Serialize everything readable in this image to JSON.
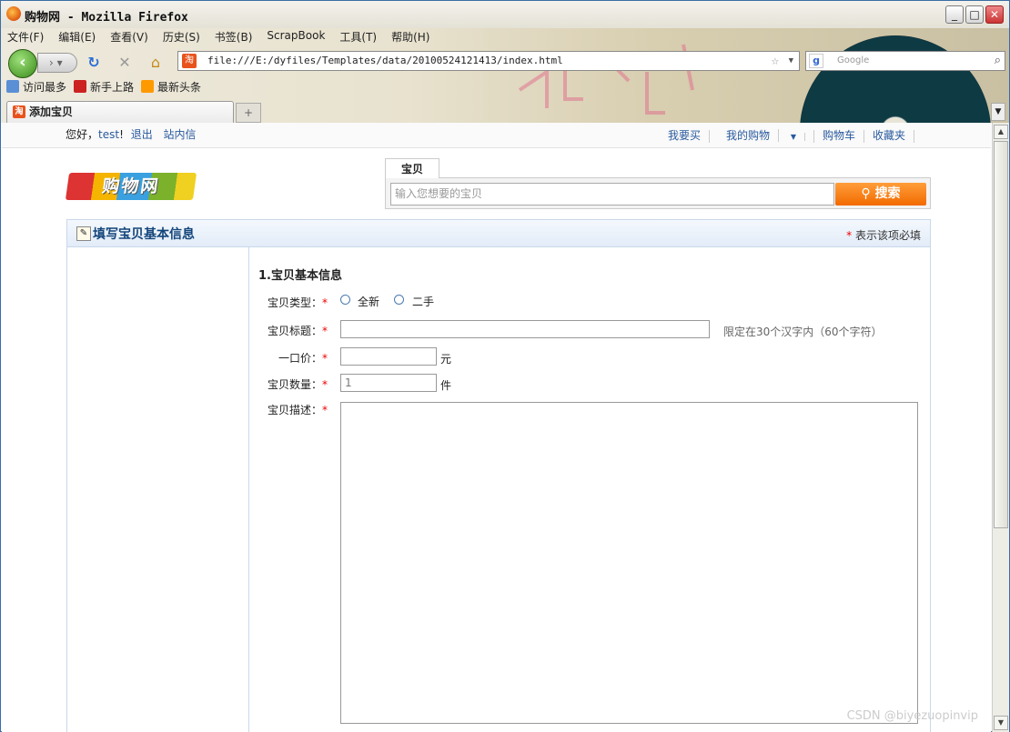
{
  "window": {
    "title": "购物网 - Mozilla Firefox"
  },
  "menubar": [
    "文件(F)",
    "编辑(E)",
    "查看(V)",
    "历史(S)",
    "书签(B)",
    "ScrapBook",
    "工具(T)",
    "帮助(H)"
  ],
  "address": {
    "url": "file:///E:/dyfiles/Templates/data/20100524121413/index.html",
    "favicon": "淘"
  },
  "searchbar": {
    "placeholder": "Google"
  },
  "bookmarks": [
    "访问最多",
    "新手上路",
    "最新头条"
  ],
  "tab": {
    "label": "添加宝贝",
    "new_tab": "+"
  },
  "site": {
    "greeting": "您好，",
    "user": "test",
    "excl": "!",
    "logout": "退出",
    "inbox": "站内信",
    "right_links": [
      "我要买",
      "我的购物",
      "购物车",
      "收藏夹"
    ],
    "logo_text": "购物网",
    "search_tab": "宝贝",
    "search_placeholder": "输入您想要的宝贝",
    "search_button": "搜索"
  },
  "panel": {
    "title": "填写宝贝基本信息",
    "required_note": "表示该项必填",
    "required_mark": "*",
    "section_title": "1.宝贝基本信息",
    "type_label": "宝贝类型：",
    "type_options": [
      "全新",
      "二手"
    ],
    "title_label": "宝贝标题：",
    "title_hint": "限定在30个汉字内（60个字符）",
    "price_label": "一口价：",
    "price_unit": "元",
    "qty_label": "宝贝数量：",
    "qty_value": "1",
    "qty_unit": "件",
    "desc_label": "宝贝描述："
  },
  "watermark": "CSDN @biyezuopinvip"
}
